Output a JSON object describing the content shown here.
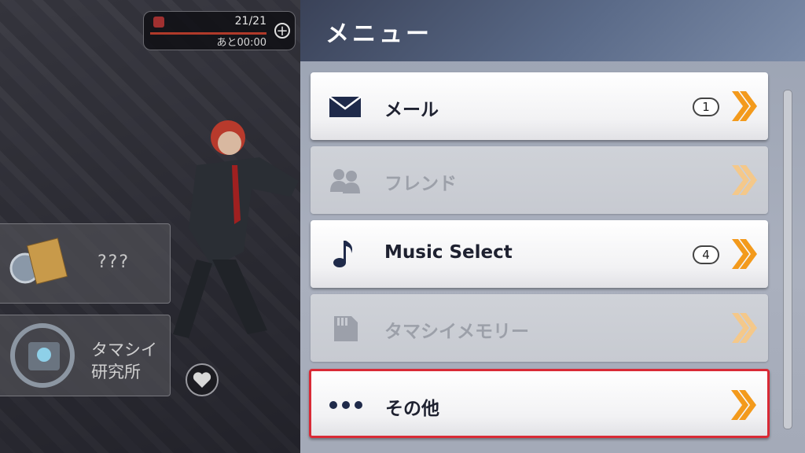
{
  "stamina": {
    "count": "21/21",
    "timer": "あと00:00",
    "plus": "+"
  },
  "side_panels": {
    "mystery_label": "???",
    "lab_line1": "タマシイ",
    "lab_line2": "研究所"
  },
  "menu": {
    "title": "メニュー",
    "items": [
      {
        "label": "メール",
        "icon": "mail-icon",
        "badge": "1",
        "enabled": true
      },
      {
        "label": "フレンド",
        "icon": "friends-icon",
        "badge": "",
        "enabled": false
      },
      {
        "label": "Music Select",
        "icon": "music-note-icon",
        "badge": "4",
        "enabled": true
      },
      {
        "label": "タマシイメモリー",
        "icon": "memory-card-icon",
        "badge": "",
        "enabled": false
      },
      {
        "label": "その他",
        "icon": "more-dots-icon",
        "badge": "",
        "enabled": true,
        "selected": true
      }
    ]
  },
  "colors": {
    "accent_orange": "#f39a1c",
    "selected_border": "#d92a36",
    "header_bg": "#3a4258"
  }
}
